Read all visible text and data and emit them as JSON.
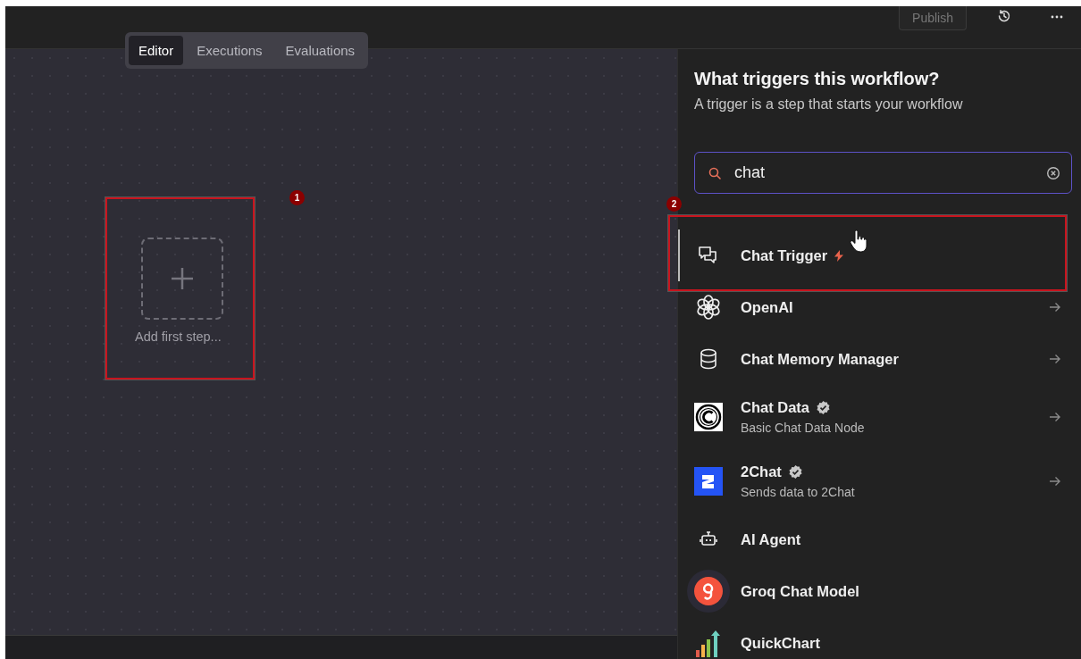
{
  "header": {
    "publish_button": "Publish"
  },
  "view_tabs": [
    {
      "label": "Editor",
      "selected": true
    },
    {
      "label": "Executions",
      "selected": false
    },
    {
      "label": "Evaluations",
      "selected": false
    }
  ],
  "canvas": {
    "add_step_label": "Add first step..."
  },
  "annotations": [
    {
      "number": "1"
    },
    {
      "number": "2"
    }
  ],
  "panel": {
    "title": "What triggers this workflow?",
    "subtitle": "A trigger is a step that starts your workflow",
    "search": {
      "value": "chat"
    },
    "items": [
      {
        "kind": "chatbubbles",
        "name": "Chat Trigger",
        "trigger": true,
        "verified": false,
        "arrow": false,
        "selected": true
      },
      {
        "kind": "knot",
        "name": "OpenAI",
        "trigger": false,
        "verified": false,
        "arrow": true,
        "selected": false
      },
      {
        "kind": "database",
        "name": "Chat Memory Manager",
        "trigger": false,
        "verified": false,
        "arrow": true,
        "selected": false
      },
      {
        "kind": "copyright",
        "name": "Chat Data",
        "description": "Basic Chat Data Node",
        "trigger": false,
        "verified": true,
        "arrow": true,
        "selected": false
      },
      {
        "kind": "twochat",
        "name": "2Chat",
        "description": "Sends data to 2Chat",
        "trigger": false,
        "verified": true,
        "arrow": true,
        "selected": false
      },
      {
        "kind": "robot",
        "name": "AI Agent",
        "trigger": false,
        "verified": false,
        "arrow": false,
        "selected": false
      },
      {
        "kind": "groq",
        "name": "Groq Chat Model",
        "trigger": false,
        "verified": false,
        "arrow": false,
        "selected": false
      },
      {
        "kind": "barchart",
        "name": "QuickChart",
        "trigger": false,
        "verified": false,
        "arrow": false,
        "selected": false
      }
    ]
  }
}
